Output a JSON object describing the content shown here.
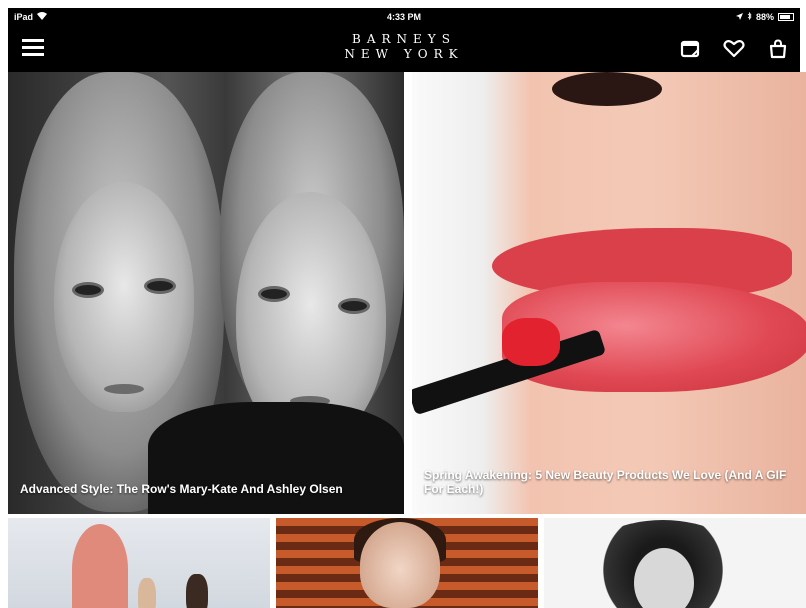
{
  "status_bar": {
    "device": "iPad",
    "time": "4:33 PM",
    "battery": "88%"
  },
  "header": {
    "logo_line1": "BARNEYS",
    "logo_line2": "NEW YORK"
  },
  "icons": {
    "menu": "menu-icon",
    "notes": "notes-icon",
    "wishlist": "heart-icon",
    "bag": "shopping-bag-icon"
  },
  "stories": [
    {
      "caption": "Advanced Style: The Row's Mary-Kate And Ashley Olsen"
    },
    {
      "caption": "Spring Awakening: 5 New Beauty Products We Love (And A GIF For Each!)"
    }
  ],
  "colors": {
    "bar": "#000000",
    "background": "#ffffff",
    "lipstick": "#e2232f"
  }
}
